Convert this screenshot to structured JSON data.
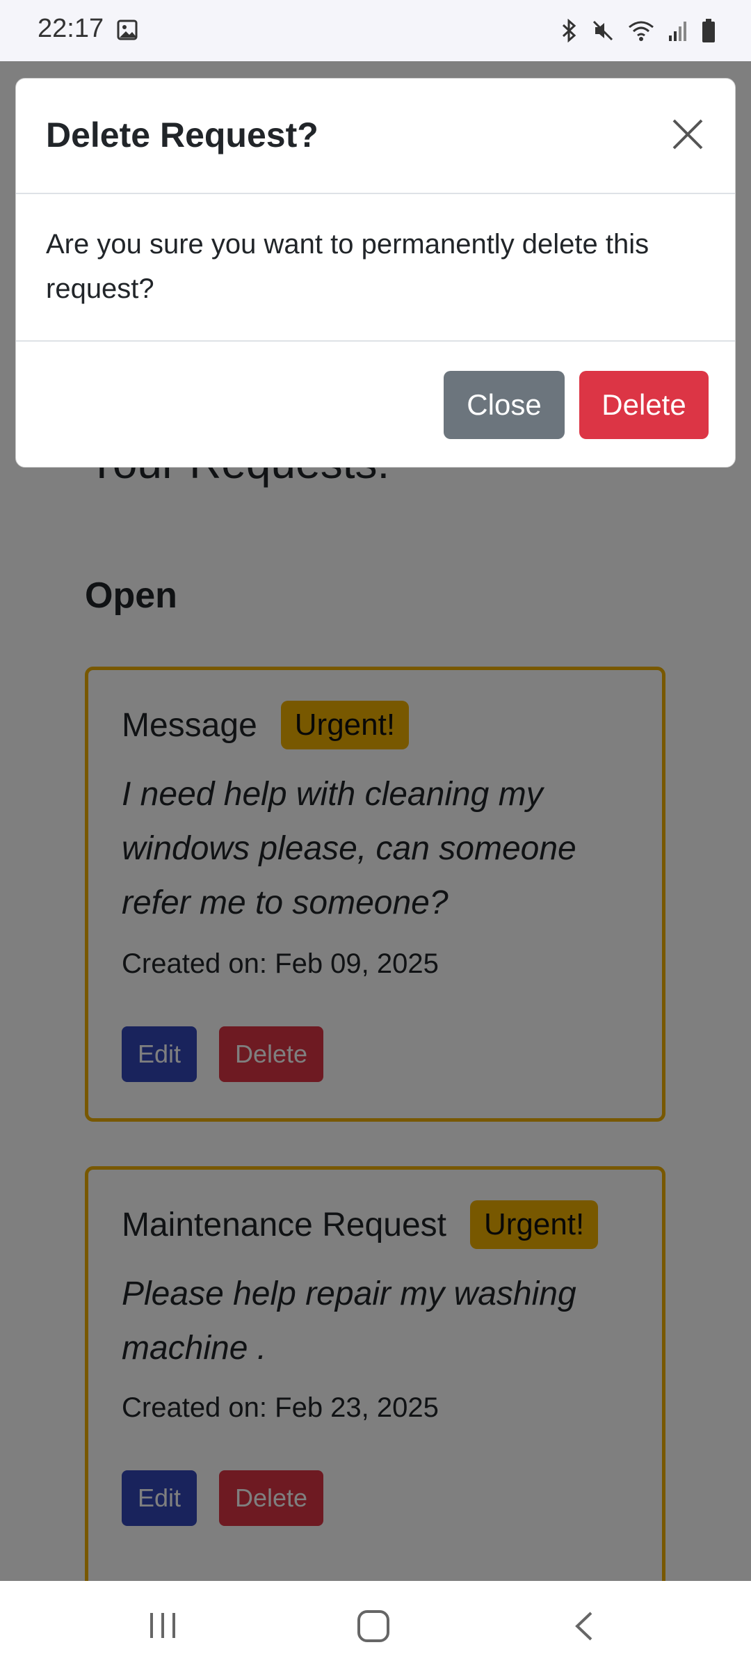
{
  "status_bar": {
    "time": "22:17",
    "icons": [
      "image-icon",
      "bluetooth-icon",
      "mute-icon",
      "wifi-icon",
      "signal-icon",
      "battery-icon"
    ]
  },
  "page": {
    "title": "Your Requests:",
    "section": "Open",
    "cards": [
      {
        "title": "Message",
        "badge": "Urgent!",
        "text": "I need help with cleaning my windows please, can someone refer me to someone?",
        "date": "Created on: Feb 09, 2025",
        "edit_label": "Edit",
        "delete_label": "Delete"
      },
      {
        "title": "Maintenance Request",
        "badge": "Urgent!",
        "text": "Please help repair my washing machine .",
        "date": "Created on: Feb 23, 2025",
        "edit_label": "Edit",
        "delete_label": "Delete"
      }
    ]
  },
  "modal": {
    "title": "Delete Request?",
    "body": "Are you sure you want to permanently delete this request?",
    "close_label": "Close",
    "delete_label": "Delete"
  },
  "colors": {
    "warning": "#f0b000",
    "danger": "#dc3545",
    "secondary": "#6c757d",
    "primary": "#3247b8"
  }
}
